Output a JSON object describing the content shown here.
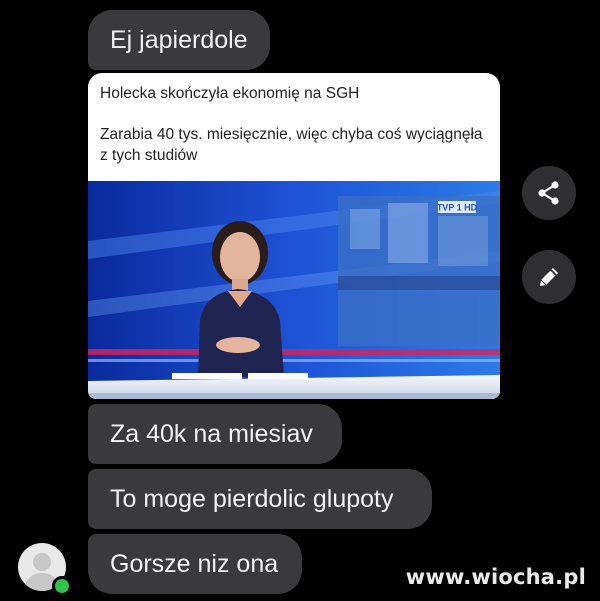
{
  "messages": [
    {
      "text": "Ej japierdole"
    },
    {
      "text": "Za 40k na miesiav"
    },
    {
      "text": "To moge pierdolic glupoty"
    },
    {
      "text": "Gorsze niz ona"
    }
  ],
  "shared_post": {
    "line1": "Holecka skończyła ekonomię na SGH",
    "line2": "Zarabia 40 tys. miesięcznie, więc chyba coś wyciągnęła z tych studiów",
    "image_badge": "TVP 1 HD"
  },
  "actions": {
    "share_icon": "share-icon",
    "edit_icon": "pencil-icon"
  },
  "avatar": {
    "icon": "default-user-avatar",
    "status_color": "#31c24d"
  },
  "watermark": "www.wiocha.pl",
  "colors": {
    "bubble": "#3a3a3c",
    "background": "#000000",
    "online": "#31c24d"
  }
}
